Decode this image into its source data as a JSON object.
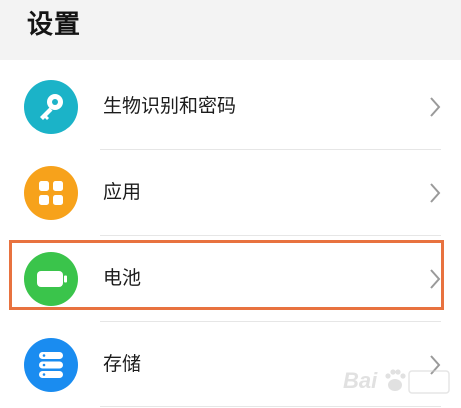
{
  "header": {
    "title": "设置"
  },
  "settings": {
    "items": [
      {
        "label": "生物识别和密码",
        "icon": "key-icon",
        "color": "#1bb3c8"
      },
      {
        "label": "应用",
        "icon": "apps-grid-icon",
        "color": "#f7a21b"
      },
      {
        "label": "电池",
        "icon": "battery-icon",
        "color": "#3ac44b"
      },
      {
        "label": "存储",
        "icon": "storage-icon",
        "color": "#1a8cf0"
      }
    ]
  },
  "highlight": {
    "color": "#e8723f",
    "target": "电池"
  },
  "watermark": {
    "text": "Bai",
    "icon": "baidu-paw-icon"
  }
}
